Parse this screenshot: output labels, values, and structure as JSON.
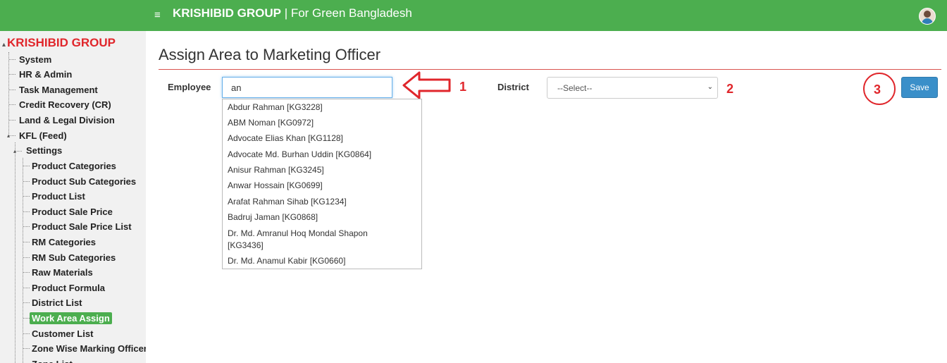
{
  "header": {
    "menu_icon": "hamburger-icon",
    "brand_bold": "KRISHIBID GROUP",
    "brand_rest": " | For Green Bangladesh",
    "avatar_icon": "user-avatar",
    "bg_color": "#4cae4f"
  },
  "sidebar": {
    "root": "KRISHIBID GROUP",
    "items": [
      "System",
      "HR & Admin",
      "Task Management",
      "Credit Recovery (CR)",
      "Land & Legal Division",
      "KFL (Feed)"
    ],
    "settings_label": "Settings",
    "settings_items": [
      "Product Categories",
      "Product Sub Categories",
      "Product List",
      "Product Sale Price",
      "Product Sale Price List",
      "RM Categories",
      "RM Sub Categories",
      "Raw Materials",
      "Product Formula",
      "District List",
      "Work Area Assign",
      "Customer List",
      "Zone Wise Marking Officer",
      "Zone List"
    ],
    "active_item": "Work Area Assign"
  },
  "main": {
    "title": "Assign Area to Marketing Officer",
    "employee_label": "Employee",
    "employee_value": "an",
    "district_label": "District",
    "district_selected": "--Select--",
    "save_label": "Save",
    "suggestions": [
      "Abdur Rahman [KG3228]",
      "ABM Noman [KG0972]",
      "Advocate Elias Khan [KG1128]",
      "Advocate Md. Burhan Uddin [KG0864]",
      "Anisur Rahman [KG3245]",
      "Anwar Hossain [KG0699]",
      "Arafat Rahman Sihab [KG1234]",
      "Badruj Jaman [KG0868]",
      "Dr. Md. Amranul Hoq Mondal Shapon",
      "[KG3436]",
      "Dr. Md. Anamul Kabir [KG0660]"
    ]
  },
  "annotations": {
    "n1": "1",
    "n2": "2",
    "n3": "3",
    "color": "#e0262b"
  }
}
